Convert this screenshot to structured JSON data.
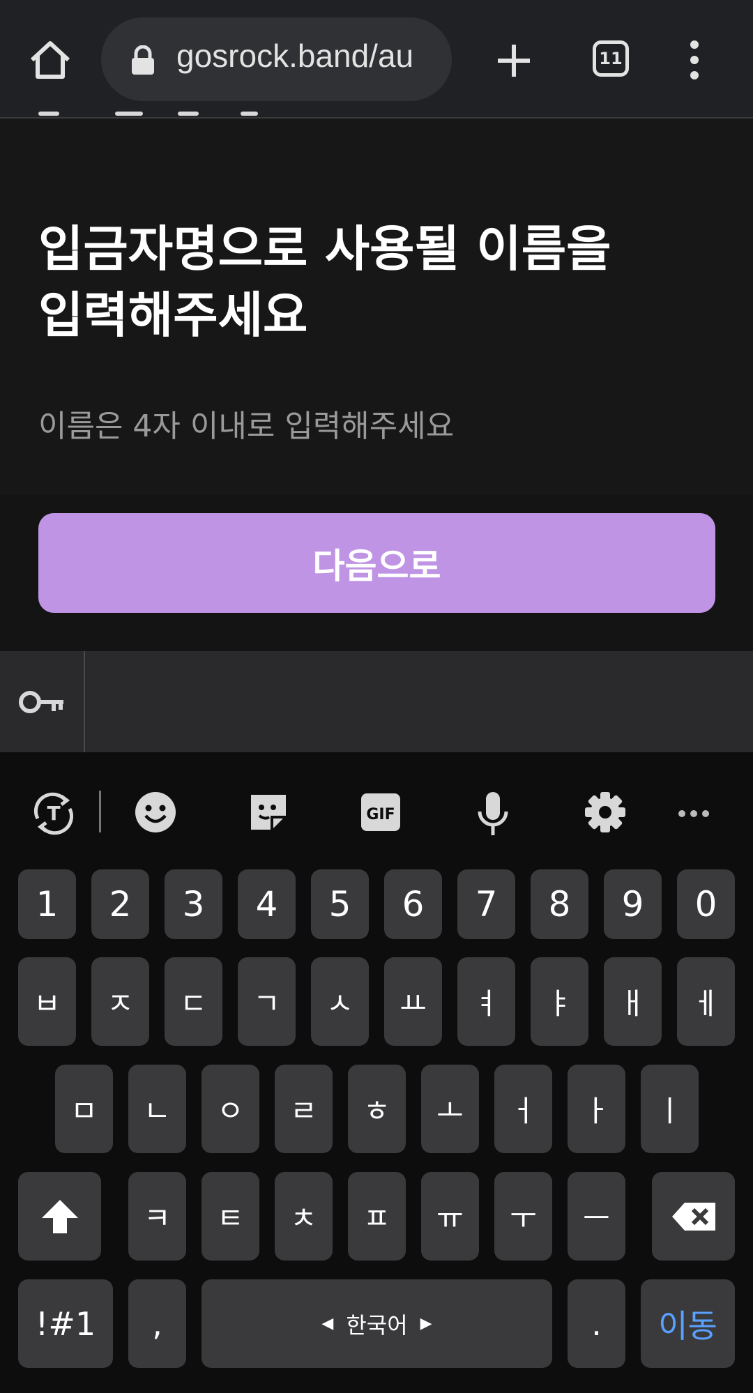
{
  "browser": {
    "url": "gosrock.band/au",
    "tab_count": "11"
  },
  "page": {
    "headline_line1": "입금자명으로 사용될 이름을",
    "headline_line2": "입력해주세요",
    "hint": "이름은 4자 이내로 입력해주세요",
    "next_button": "다음으로"
  },
  "colors": {
    "accent": "#bf94e4",
    "keyboard_bg": "#0d0d0d",
    "key_bg": "#3a3a3c",
    "enter_text": "#5aa0ff"
  },
  "keyboard": {
    "toolbar_icons": [
      "translate-icon",
      "emoji-icon",
      "sticker-icon",
      "gif-icon",
      "mic-icon",
      "settings-icon",
      "more-icon"
    ],
    "gif_label": "GIF",
    "row_numbers": [
      "1",
      "2",
      "3",
      "4",
      "5",
      "6",
      "7",
      "8",
      "9",
      "0"
    ],
    "row1": [
      "ㅂ",
      "ㅈ",
      "ㄷ",
      "ㄱ",
      "ㅅ",
      "ㅛ",
      "ㅕ",
      "ㅑ",
      "ㅐ",
      "ㅔ"
    ],
    "row2": [
      "ㅁ",
      "ㄴ",
      "ㅇ",
      "ㄹ",
      "ㅎ",
      "ㅗ",
      "ㅓ",
      "ㅏ",
      "ㅣ"
    ],
    "row3": [
      "ㅋ",
      "ㅌ",
      "ㅊ",
      "ㅍ",
      "ㅠ",
      "ㅜ",
      "ㅡ"
    ],
    "symbols_key": "!#1",
    "comma_key": ",",
    "space_label": "한국어",
    "period_key": ".",
    "enter_key": "이동"
  }
}
